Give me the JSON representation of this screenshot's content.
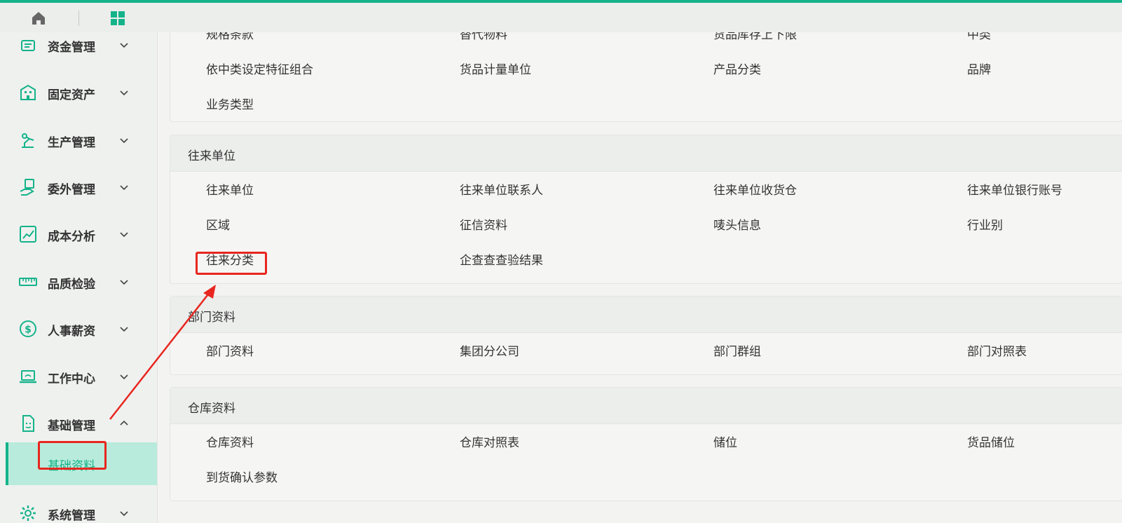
{
  "colors": {
    "accent": "#14b38a",
    "highlight_bg": "#b8ebdb",
    "annotation_red": "#e8261f"
  },
  "topbar": {
    "home_icon": "home-icon",
    "apps_icon": "apps-grid-icon"
  },
  "sidebar": {
    "items": [
      {
        "label": "资金管理",
        "icon": "fund-icon",
        "expanded": false
      },
      {
        "label": "固定资产",
        "icon": "building-icon",
        "expanded": false
      },
      {
        "label": "生产管理",
        "icon": "robot-arm-icon",
        "expanded": false
      },
      {
        "label": "委外管理",
        "icon": "hand-document-icon",
        "expanded": false
      },
      {
        "label": "成本分析",
        "icon": "line-chart-icon",
        "expanded": false
      },
      {
        "label": "品质检验",
        "icon": "ruler-icon",
        "expanded": false
      },
      {
        "label": "人事薪资",
        "icon": "dollar-circle-icon",
        "expanded": false
      },
      {
        "label": "工作中心",
        "icon": "laptop-icon",
        "expanded": false
      },
      {
        "label": "基础管理",
        "icon": "document-face-icon",
        "expanded": true
      },
      {
        "label": "系统管理",
        "icon": "gear-icon",
        "expanded": false
      }
    ],
    "active_sub": {
      "label": "基础资料"
    }
  },
  "cards": [
    {
      "title": "",
      "rows": [
        [
          "规格条款",
          "替代物料",
          "货品库存上下限",
          "中类"
        ],
        [
          "依中类设定特征组合",
          "货品计量单位",
          "产品分类",
          "品牌"
        ],
        [
          "业务类型"
        ]
      ]
    },
    {
      "title": "往来单位",
      "rows": [
        [
          "往来单位",
          "往来单位联系人",
          "往来单位收货仓",
          "往来单位银行账号"
        ],
        [
          "区域",
          "征信资料",
          "唛头信息",
          "行业别"
        ],
        [
          "往来分类",
          "企查查查验结果"
        ]
      ]
    },
    {
      "title": "部门资料",
      "rows": [
        [
          "部门资料",
          "集团分公司",
          "部门群组",
          "部门对照表"
        ]
      ]
    },
    {
      "title": "仓库资料",
      "rows": [
        [
          "仓库资料",
          "仓库对照表",
          "储位",
          "货品储位"
        ],
        [
          "到货确认参数"
        ]
      ]
    }
  ]
}
